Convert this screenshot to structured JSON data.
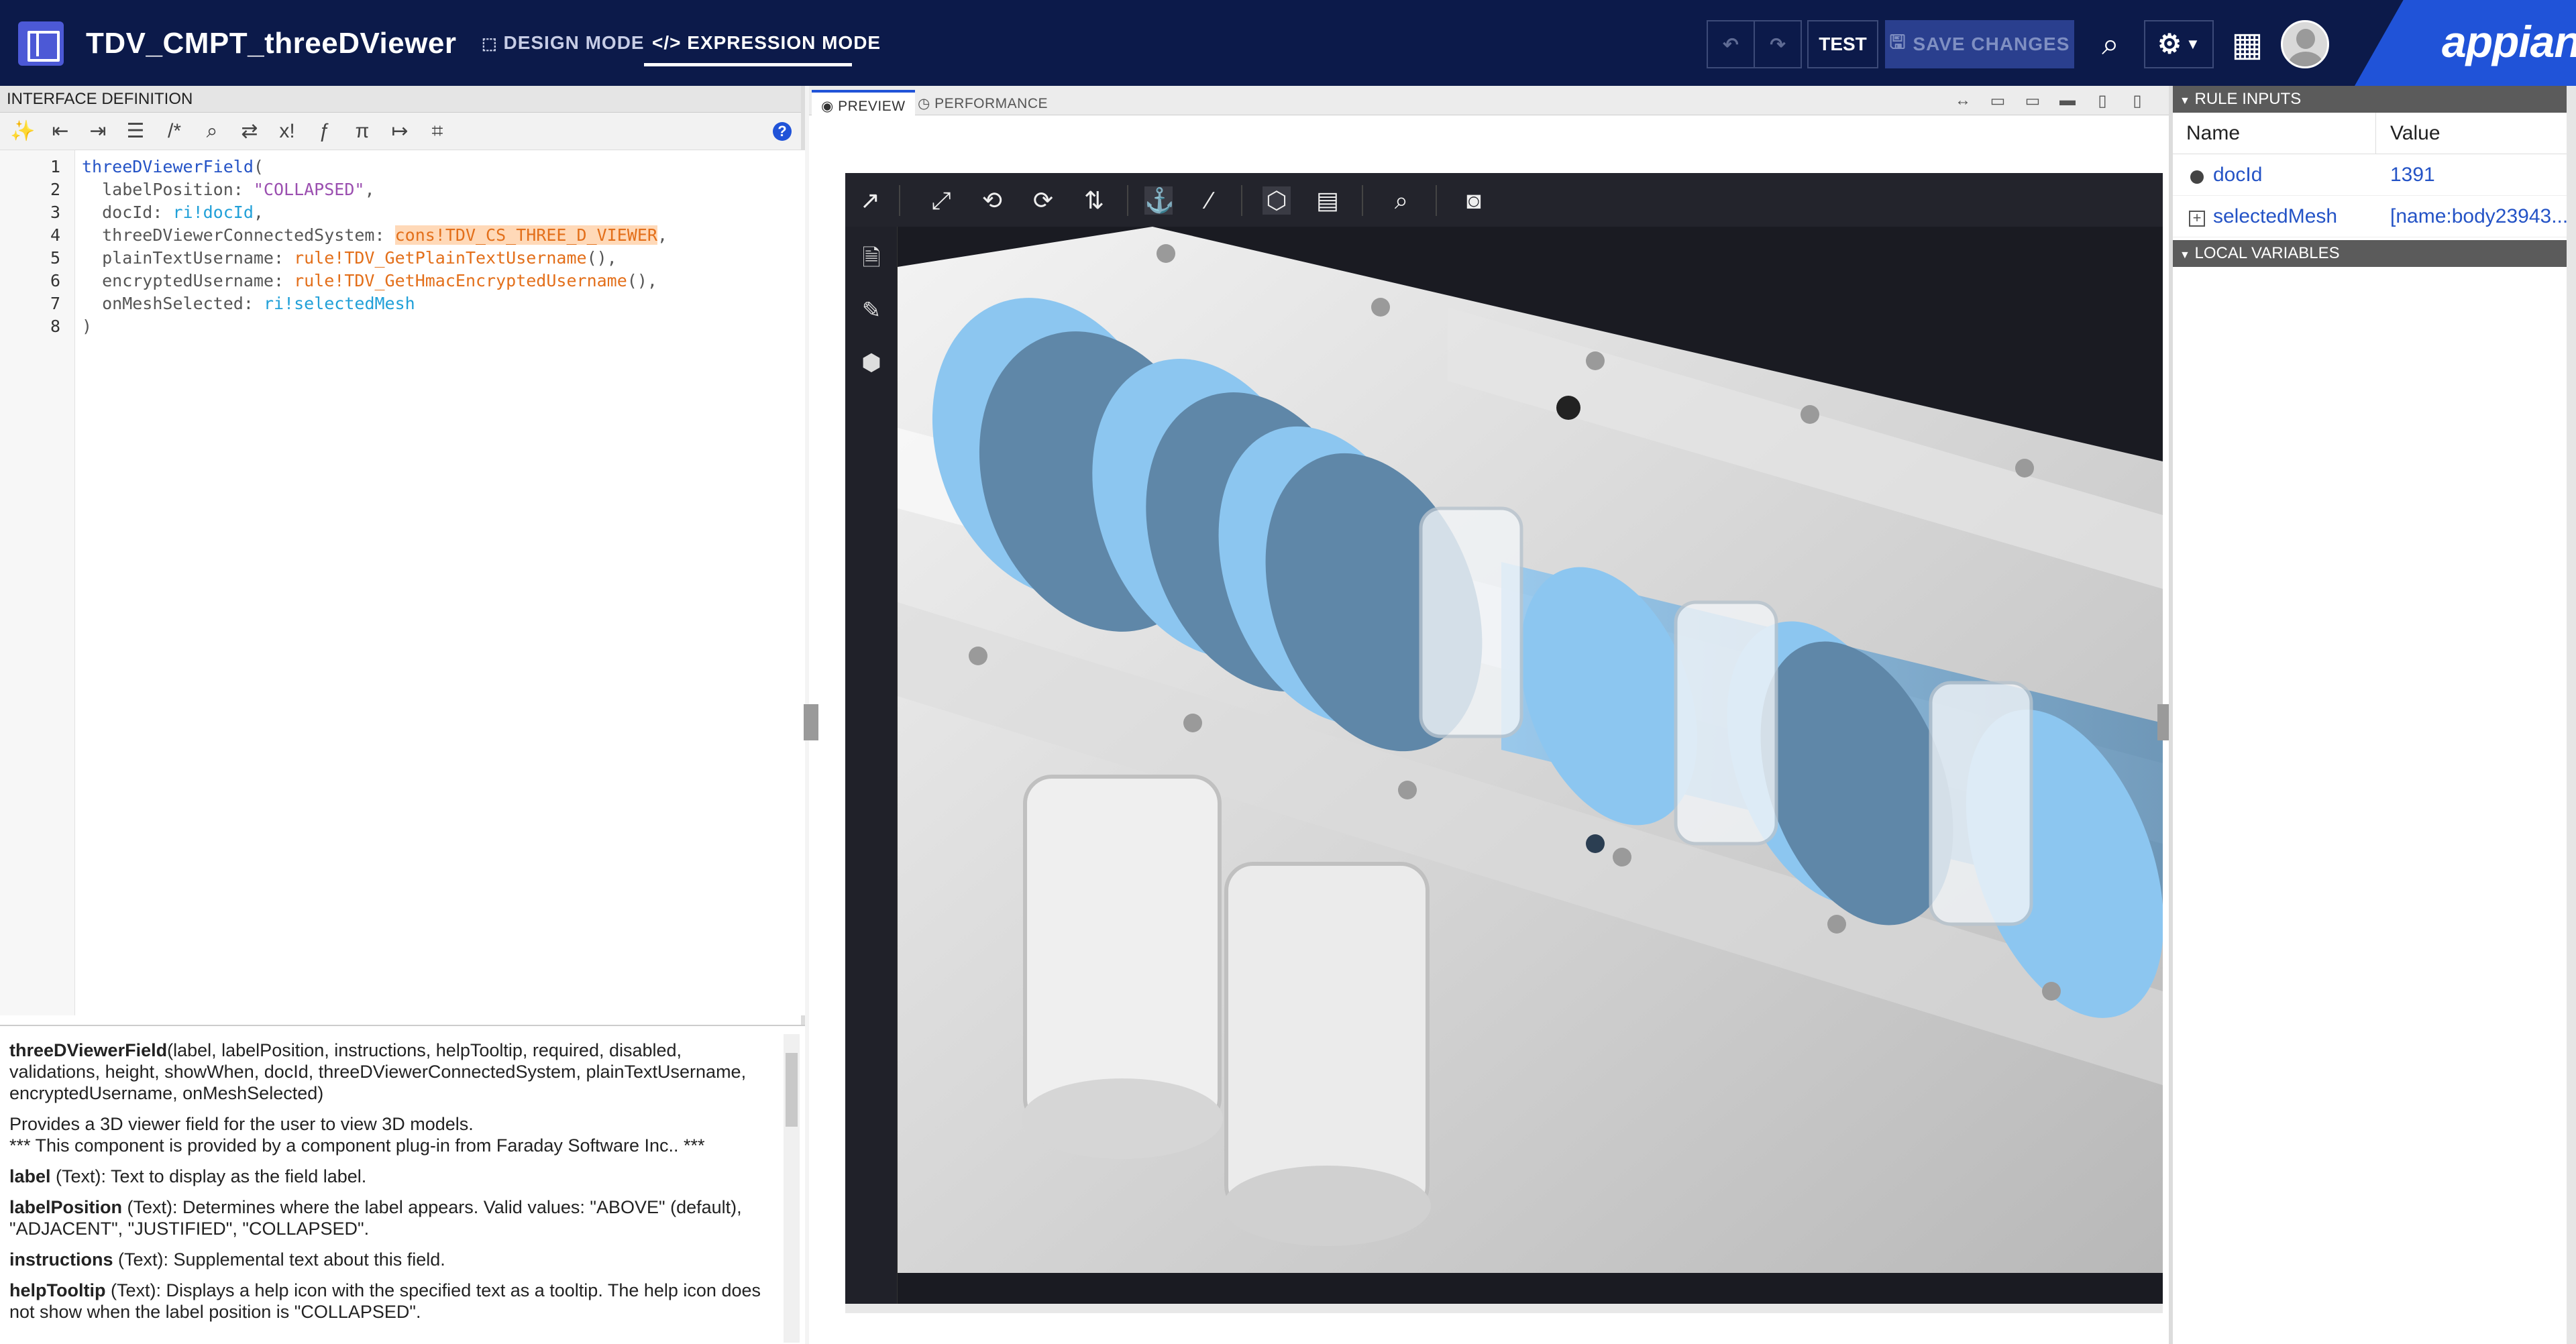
{
  "header": {
    "title": "TDV_CMPT_threeDViewer",
    "design_mode": "DESIGN MODE",
    "expression_mode": "EXPRESSION MODE",
    "undo_icon": "undo-icon",
    "redo_icon": "redo-icon",
    "test_label": "TEST",
    "save_label": "SAVE CHANGES",
    "logo": "appian",
    "brand_color": "#0c1a4a",
    "accent_color": "#2053d8"
  },
  "left_panel": {
    "title": "INTERFACE DEFINITION",
    "code_lines": [
      {
        "n": "1",
        "parts": [
          [
            "fn",
            "threeDViewerField"
          ],
          [
            "plain",
            "("
          ]
        ]
      },
      {
        "n": "2",
        "parts": [
          [
            "plain",
            "  labelPosition: "
          ],
          [
            "str",
            "\"COLLAPSED\""
          ],
          [
            "plain",
            ","
          ]
        ]
      },
      {
        "n": "3",
        "parts": [
          [
            "plain",
            "  docId: "
          ],
          [
            "ri",
            "ri!docId"
          ],
          [
            "plain",
            ","
          ]
        ]
      },
      {
        "n": "4",
        "parts": [
          [
            "plain",
            "  threeDViewerConnectedSystem: "
          ],
          [
            "cons",
            "cons!TDV_CS_THREE_D_VIEWER"
          ],
          [
            "plain",
            ","
          ]
        ]
      },
      {
        "n": "5",
        "parts": [
          [
            "plain",
            "  plainTextUsername: "
          ],
          [
            "rule",
            "rule!TDV_GetPlainTextUsername"
          ],
          [
            "plain",
            "(),"
          ]
        ]
      },
      {
        "n": "6",
        "parts": [
          [
            "plain",
            "  encryptedUsername: "
          ],
          [
            "rule",
            "rule!TDV_GetHmacEncryptedUsername"
          ],
          [
            "plain",
            "(),"
          ]
        ]
      },
      {
        "n": "7",
        "parts": [
          [
            "plain",
            "  onMeshSelected: "
          ],
          [
            "ri",
            "ri!selectedMesh"
          ]
        ]
      },
      {
        "n": "8",
        "parts": [
          [
            "plain",
            ")"
          ]
        ]
      }
    ],
    "doc": {
      "signature_name": "threeDViewerField",
      "signature_args": "(label, labelPosition, instructions, helpTooltip, required, disabled, validations, height, showWhen, docId, threeDViewerConnectedSystem, plainTextUsername, encryptedUsername, onMeshSelected)",
      "desc1": "Provides a 3D viewer field for the user to view 3D models.",
      "desc2": "*** This component is provided by a component plug-in from Faraday Software Inc.. ***",
      "params": [
        {
          "name": "label",
          "text": " (Text): Text to display as the field label."
        },
        {
          "name": "labelPosition",
          "text": " (Text): Determines where the label appears. Valid values: \"ABOVE\" (default), \"ADJACENT\", \"JUSTIFIED\", \"COLLAPSED\"."
        },
        {
          "name": "instructions",
          "text": " (Text): Supplemental text about this field."
        },
        {
          "name": "helpTooltip",
          "text": " (Text): Displays a help icon with the specified text as a tooltip. The help icon does not show when the label position is \"COLLAPSED\"."
        }
      ]
    }
  },
  "center": {
    "tab_preview": "PREVIEW",
    "tab_performance": "PERFORMANCE"
  },
  "right_panel": {
    "rule_inputs_title": "RULE INPUTS",
    "col_name": "Name",
    "col_value": "Value",
    "rows": [
      {
        "name": "docId",
        "value": "1391"
      },
      {
        "name": "selectedMesh",
        "value": "[name:body23943..."
      }
    ],
    "local_vars_title": "LOCAL VARIABLES"
  }
}
